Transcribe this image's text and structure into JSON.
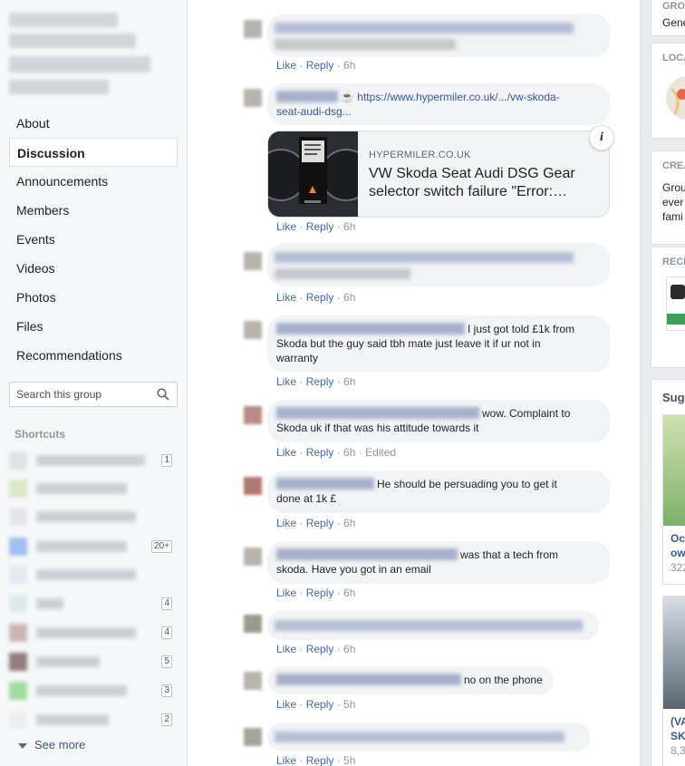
{
  "nav": {
    "items": [
      "About",
      "Discussion",
      "Announcements",
      "Members",
      "Events",
      "Videos",
      "Photos",
      "Files",
      "Recommendations"
    ],
    "active": "Discussion"
  },
  "search": {
    "placeholder": "Search this group"
  },
  "shortcuts": {
    "title": "Shortcuts",
    "counts": [
      "1",
      "",
      "",
      "20+",
      "",
      "4",
      "4",
      "5",
      "3",
      "2"
    ],
    "see_more": "See more"
  },
  "actions": {
    "like": "Like",
    "reply": "Reply",
    "dot": " · ",
    "edited": "Edited"
  },
  "comments": [
    {
      "time": "6h"
    },
    {
      "time": "6h",
      "link_icon": "☕",
      "link_line1": "https://www.hypermiler.co.uk/.../vw-skoda-",
      "link_line2": "seat-audi-dsg...",
      "card_domain": "HYPERMILER.CO.UK",
      "card_title_1": "VW Skoda Seat Audi DSG Gear",
      "card_title_2": "selector switch failure \"Error:…"
    },
    {
      "time": "6h"
    },
    {
      "time": "6h",
      "text_1": "I just got told £1k from",
      "text_2": "Skoda but the guy said tbh mate just leave it if ur not in",
      "text_3": "warranty"
    },
    {
      "time": "6h",
      "text_1": "wow. Complaint to",
      "text_2": "Skoda uk if that was his attitude towards it",
      "edited": true
    },
    {
      "time": "6h",
      "text_1": "He should be persuading you to get it",
      "text_2": "done at 1k £"
    },
    {
      "time": "6h",
      "text_1": "was that a tech from",
      "text_2": "skoda. Have you got in an email"
    },
    {
      "time": "6h"
    },
    {
      "time": "5h",
      "text_1": "no on the phone"
    },
    {
      "time": "5h"
    }
  ],
  "right": {
    "labels": [
      "GRO",
      "LOCA",
      "CREA",
      "RECE",
      "Sugg"
    ],
    "texts": [
      "Gene",
      "Grou",
      "ever",
      "fami",
      "Oct",
      "ow",
      "322",
      "(VA",
      "SK",
      "8,3"
    ]
  }
}
